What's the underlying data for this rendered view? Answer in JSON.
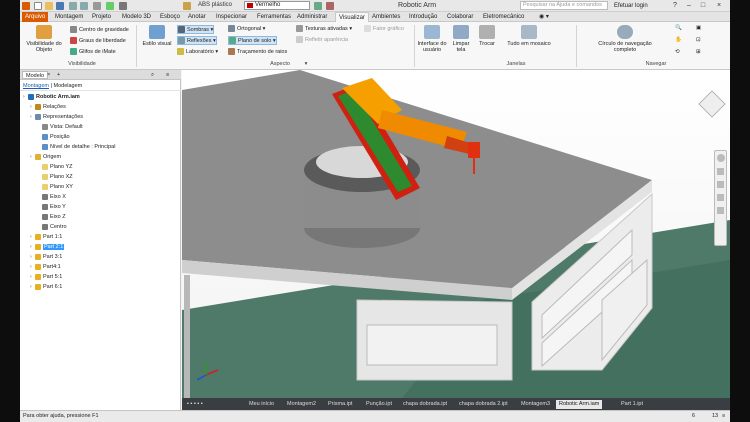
{
  "title_bar": {
    "material": "ABS plástico",
    "appearance": "Vermelho",
    "document_title": "Robotic Arm",
    "search_placeholder": "Pesquisar na Ajuda e comandos",
    "login": "Efetuar login"
  },
  "ribbon_tabs": [
    "Arquivo",
    "Montagem",
    "Projeto",
    "Modelo 3D",
    "Esboço",
    "Anotar",
    "Inspecionar",
    "Ferramentas",
    "Administrar",
    "Visualizar",
    "Ambientes",
    "Introdução",
    "Colaborar",
    "Eletromecânico"
  ],
  "active_tab": "Visualizar",
  "ribbon": {
    "visibility": {
      "label": "Visibilidade",
      "big_button": "Visibilidade do Objeto",
      "items": [
        "Centro de gravidade",
        "Graus de liberdade",
        "Glifos de iMate"
      ]
    },
    "appearance": {
      "label": "Aspecto",
      "style_button": "Estilo visual",
      "items": [
        "Sombras",
        "Reflexões",
        "Laboratório",
        "Ortogonal",
        "Plano de solo",
        "Traçamento de raios",
        "Texturas ativadas",
        "Refletir aparência"
      ],
      "extra": "Fator gráfico"
    },
    "windows": {
      "label": "Janelas",
      "buttons": [
        "Interface do usuário",
        "Limpar tela",
        "Trocar",
        "Tudo em mosaico"
      ]
    },
    "navigate": {
      "label": "Navegar",
      "button": "Círculo de navegação completo"
    }
  },
  "browser": {
    "tabs": [
      "Modelo",
      "+"
    ],
    "sub_links": [
      "Montagem",
      "Modelagem"
    ],
    "tree": [
      {
        "label": "Robotic Arm.iam",
        "level": 0,
        "bold": true,
        "color": "#1f6fbf"
      },
      {
        "label": "Relações",
        "level": 1,
        "color": "#c08a1a"
      },
      {
        "label": "Representações",
        "level": 1,
        "color": "#6b8cae"
      },
      {
        "label": "Vista: Default",
        "level": 2,
        "color": "#888888"
      },
      {
        "label": "Posição",
        "level": 2,
        "color": "#5a8fc8"
      },
      {
        "label": "Nível de detalhe : Principal",
        "level": 2,
        "color": "#5a8fc8"
      },
      {
        "label": "Origem",
        "level": 1,
        "color": "#e0b030"
      },
      {
        "label": "Plano YZ",
        "level": 2,
        "color": "#e8d070"
      },
      {
        "label": "Plano XZ",
        "level": 2,
        "color": "#e8d070"
      },
      {
        "label": "Plano XY",
        "level": 2,
        "color": "#e8d070"
      },
      {
        "label": "Eixo X",
        "level": 2,
        "color": "#777777"
      },
      {
        "label": "Eixo Y",
        "level": 2,
        "color": "#777777"
      },
      {
        "label": "Eixo Z",
        "level": 2,
        "color": "#777777"
      },
      {
        "label": "Centro",
        "level": 2,
        "color": "#777777"
      },
      {
        "label": "Part 1:1",
        "level": 1,
        "color": "#e8b020"
      },
      {
        "label": "Part 2:1",
        "level": 1,
        "color": "#e8b020",
        "selected": true
      },
      {
        "label": "Part 3:1",
        "level": 1,
        "color": "#e8b020"
      },
      {
        "label": "Part4:1",
        "level": 1,
        "color": "#e8b020"
      },
      {
        "label": "Part 5:1",
        "level": 1,
        "color": "#e8b020"
      },
      {
        "label": "Part 6:1",
        "level": 1,
        "color": "#e8b020"
      }
    ]
  },
  "doc_tabs": [
    "Meu início",
    "Montagem2",
    "Prisma.ipt",
    "Punção.ipt",
    "chapa dobrada.ipt",
    "chapa dobrada 2.ipt",
    "Montagem3",
    "Robotic Arm.iam",
    "Part 1.ipt"
  ],
  "active_doc": "Robotic Arm.iam",
  "status": {
    "help": "Para obter ajuda, pressione F1",
    "count_a": "6",
    "count_b": "13"
  },
  "colors": {
    "file_tab": "#d95a00",
    "arm_orange": "#f5a000",
    "arm_red": "#d02010",
    "arm_green": "#2e8a2e",
    "selection": "#3399ff"
  }
}
